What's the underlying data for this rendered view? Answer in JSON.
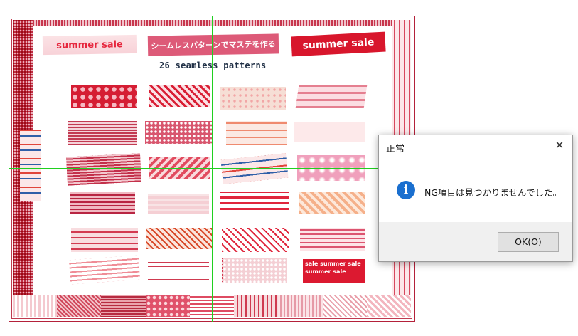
{
  "banner": {
    "left_tape_text": "summer sale",
    "center_tape_text": "シームレスパターンでマステを作る",
    "right_tape_text": "summer sale",
    "subtitle": "26 seamless patterns",
    "bottom_tape_text": "sale summer sale summer sale"
  },
  "colors": {
    "accent_red": "#d91f35",
    "pink": "#e46a86",
    "light_pink": "#f6cdd3",
    "crosshair": "#20d020"
  },
  "dialog": {
    "title": "正常",
    "close_glyph": "✕",
    "icon_name": "info-icon",
    "icon_glyph": "i",
    "message": "NG項目は見つかりませんでした。",
    "ok_label": "OK(O)"
  }
}
